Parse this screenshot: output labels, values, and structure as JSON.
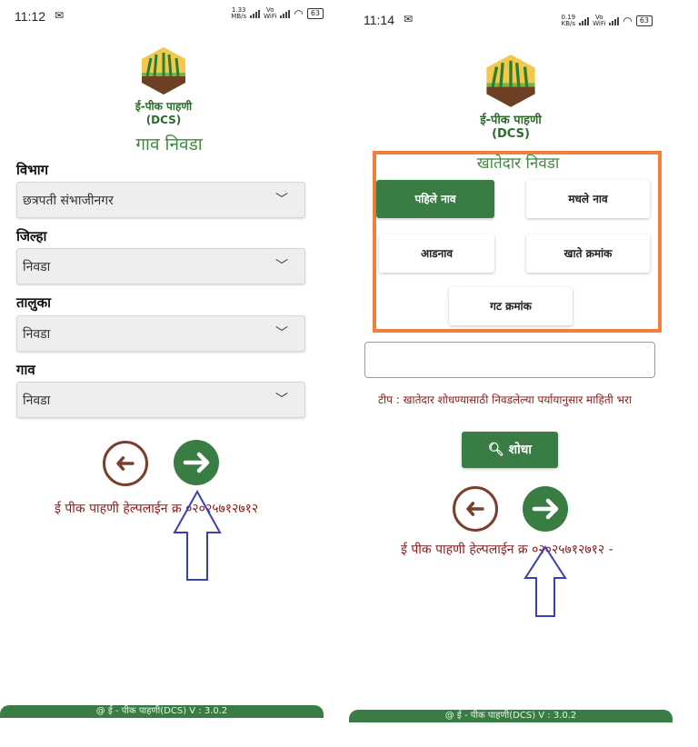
{
  "left": {
    "status": {
      "time": "11:12",
      "mail_icon": "mail-icon",
      "net_speed": "1.33",
      "net_unit": "MB/s",
      "volte": "Vo",
      "volte_sub": "WiFi",
      "battery": "63"
    },
    "logo": {
      "title": "ई-पीक पाहणी",
      "subtitle": "(DCS)"
    },
    "page_title": "गाव निवडा",
    "fields": [
      {
        "label": "विभाग",
        "value": "छत्रपती संभाजीनगर"
      },
      {
        "label": "जिल्हा",
        "value": "निवडा"
      },
      {
        "label": "तालुका",
        "value": "निवडा"
      },
      {
        "label": "गाव",
        "value": "निवडा"
      }
    ],
    "helpline": "ई पीक पाहणी हेल्पलाईन क्र ०२०२५७१२७१२",
    "footer": "@ ई - पीक पाहणी(DCS) V  :  3.0.2"
  },
  "right": {
    "status": {
      "time": "11:14",
      "mail_icon": "mail-icon",
      "net_speed": "0.19",
      "net_unit": "KB/s",
      "volte": "Vo",
      "volte_sub": "WiFi",
      "battery": "63"
    },
    "logo": {
      "title": "ई-पीक पाहणी",
      "subtitle": "(DCS)"
    },
    "box_title": "खातेदार निवडा",
    "options": {
      "first_name": "पहिले नाव",
      "middle_name": "मधले नाव",
      "surname": "आडनाव",
      "account_number": "खाते क्रमांक",
      "group_number": "गट क्रमांक"
    },
    "search_input": {
      "value": ""
    },
    "tip": "टीप : खातेदार शोधण्यासाठी निवडलेल्या पर्यायानुसार माहिती भरा",
    "search_label": "शोधा",
    "helpline": "ई पीक पाहणी हेल्पलाईन क्र ०२०२५७१२७१२ -",
    "footer": "@ ई - पीक पाहणी(DCS) V  :  3.0.2"
  },
  "colors": {
    "primary_green": "#3a7d44",
    "title_green": "#3f8a3f",
    "back_brown": "#7a3e2e",
    "helpline_red": "#8b1a1a",
    "highlight_orange": "#f0803c",
    "annotation_blue": "#3b3fb5"
  }
}
